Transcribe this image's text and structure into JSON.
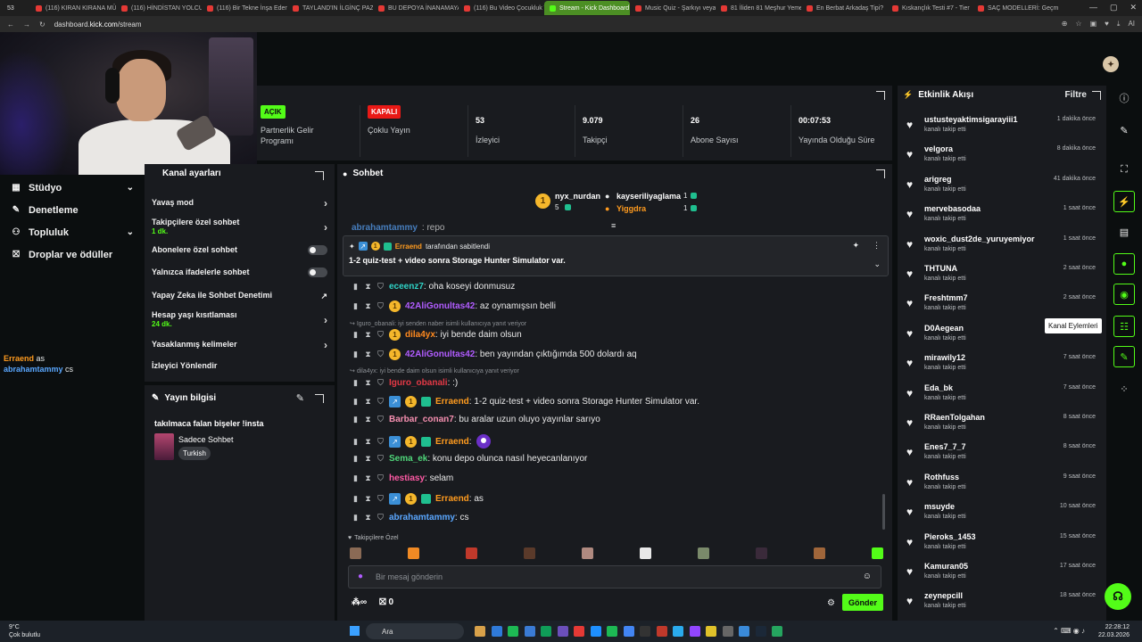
{
  "browser": {
    "tabs": [
      {
        "label": "(116) KIRAN KIRANA MÜC"
      },
      {
        "label": "(116) HİNDİSTAN YOLCU"
      },
      {
        "label": "(116) Bir Tekne İnşa Eden"
      },
      {
        "label": "TAYLAND'IN İLGİNÇ PAZ"
      },
      {
        "label": "BU DEPOYA İNANAMAYAC"
      },
      {
        "label": "(116) Bu Video Çocukluk T"
      },
      {
        "label": "Stream - Kick Dashboard",
        "active": true
      },
      {
        "label": "Music Quiz - Şarkıyı veya"
      },
      {
        "label": "81 İliden 81 Meşhur Yemek"
      },
      {
        "label": "En Berbat Arkadaş Tipi?"
      },
      {
        "label": "Kıskançlık Testi #7 - Tier"
      },
      {
        "label": "SAÇ MODELLERİ: Geçmiş"
      }
    ],
    "tab_count": "53",
    "url_prefix": "dashboard.",
    "url_domain": "kick.com",
    "url_path": "/stream",
    "ai_label": "AI"
  },
  "left_nav": {
    "items": [
      {
        "label": "Stüdyo",
        "icon": "studio-icon",
        "chevron": true
      },
      {
        "label": "Denetleme",
        "icon": "wrench-icon"
      },
      {
        "label": "Topluluk",
        "icon": "community-icon",
        "chevron": true
      },
      {
        "label": "Droplar ve ödüller",
        "icon": "drops-icon"
      }
    ]
  },
  "overlay_chat": [
    {
      "user": "Erraend",
      "text": "as"
    },
    {
      "user": "abrahamtammy",
      "text": "cs"
    }
  ],
  "stats": {
    "partner": {
      "pill": "AÇIK",
      "label_line1": "Partnerlik Gelir",
      "label_line2": "Programı"
    },
    "multistream": {
      "pill": "KAPALI",
      "label": "Çoklu Yayın"
    },
    "viewers": {
      "value": "53",
      "label": "İzleyici"
    },
    "followers": {
      "value": "9.079",
      "label": "Takipçi"
    },
    "subs": {
      "value": "26",
      "label": "Abone Sayısı"
    },
    "uptime": {
      "value": "00:07:53",
      "label": "Yayında Olduğu Süre"
    }
  },
  "mod_panel": {
    "title": "Kanal ayarları",
    "items": [
      {
        "label": "Yavaş mod",
        "type": "chevron"
      },
      {
        "label": "Takipçilere özel sohbet",
        "sub": "1 dk.",
        "type": "chevron"
      },
      {
        "label": "Abonelere özel sohbet",
        "type": "toggle"
      },
      {
        "label": "Yalnızca ifadelerle sohbet",
        "type": "toggle"
      },
      {
        "label": "Yapay Zeka ile Sohbet Denetimi",
        "type": "link"
      },
      {
        "label": "Hesap yaşı kısıtlaması",
        "sub": "24 dk.",
        "type": "chevron"
      },
      {
        "label": "Yasaklanmış kelimeler",
        "type": "chevron"
      },
      {
        "label": "İzleyici Yönlendir",
        "type": "none"
      }
    ]
  },
  "stream_info": {
    "title": "Yayın bilgisi",
    "stream_title": "takılmaca falan bişeler !insta",
    "category": "Sadece Sohbet",
    "language": "Turkish"
  },
  "chat": {
    "title": "Sohbet",
    "leaders": [
      {
        "name": "nyx_nurdan",
        "count": "5"
      },
      {
        "name": "kayseriliyaglama",
        "count": "1"
      },
      {
        "name": "Yiggdra",
        "count": "1"
      }
    ],
    "cut_message": {
      "user": "abrahamtammy",
      "text": ": repo"
    },
    "pinned": {
      "by_user": "Erraend",
      "by_text": "tarafından sabitlendi",
      "text": "1-2 quiz-test + video sonra Storage Hunter Simulator var."
    },
    "messages": [
      {
        "user": "eceenz7",
        "color": "#2fd3c6",
        "text": ": oha koseyi donmusuz",
        "badges": []
      },
      {
        "user": "42AliGonultas42",
        "color": "#b15cff",
        "text": ": az oynamışsın belli",
        "badges": [
          "sub"
        ]
      },
      {
        "reply": "Iguro_obanali: iyi senden naber isimli kullanıcıya yanıt veriyor"
      },
      {
        "user": "dila4yx",
        "color": "#ff8a1f",
        "text": ": iyi bende daim olsun",
        "badges": [
          "sub"
        ]
      },
      {
        "user": "42AliGonultas42",
        "color": "#b15cff",
        "text": ": ben yayından çıktığımda 500 dolardı aq",
        "badges": [
          "sub"
        ]
      },
      {
        "reply": "dila4yx: iyi bende daim olsun isimli kullanıcıya yanıt veriyor"
      },
      {
        "user": "Iguro_obanali",
        "color": "#e53946",
        "text": ": :)",
        "badges": []
      },
      {
        "user": "Erraend",
        "color": "#ff9b1f",
        "text": ": 1-2 quiz-test + video sonra Storage Hunter Simulator var.",
        "badges": [
          "vip",
          "sub",
          "gift"
        ]
      },
      {
        "user": "Barbar_conan7",
        "color": "#f58fb0",
        "text": ": bu aralar uzun oluyo yayınlar sarıyo",
        "badges": []
      },
      {
        "user": "Erraend",
        "color": "#ff9b1f",
        "text": ":",
        "badges": [
          "vip",
          "sub",
          "gift"
        ],
        "emote": true
      },
      {
        "user": "Sema_ek",
        "color": "#4fd67a",
        "text": ": konu depo olunca nasıl heyecanlanıyor",
        "badges": []
      },
      {
        "user": "hestiasy",
        "color": "#ff5aa5",
        "text": ": selam",
        "badges": []
      },
      {
        "user": "Erraend",
        "color": "#ff9b1f",
        "text": ": as",
        "badges": [
          "vip",
          "sub",
          "gift"
        ]
      },
      {
        "user": "abrahamtammy",
        "color": "#5aa7ff",
        "text": ": cs",
        "badges": []
      }
    ],
    "followers_only_label": "Takipçilere Özel",
    "input_placeholder": "Bir mesaj gönderin",
    "infinity_label": "∞",
    "gift_count": "0",
    "send_label": "Gönder"
  },
  "activity": {
    "title": "Etkinlik Akışı",
    "filter": "Filtre",
    "items": [
      {
        "name": "ustusteyaktimsigarayiii1",
        "sub": "kanalı takip etti",
        "time": "1 dakika önce"
      },
      {
        "name": "velgora",
        "sub": "kanalı takip etti",
        "time": "8 dakika önce"
      },
      {
        "name": "arigreg",
        "sub": "kanalı takip etti",
        "time": "41 dakika önce"
      },
      {
        "name": "mervebasodaa",
        "sub": "kanalı takip etti",
        "time": "1 saat önce"
      },
      {
        "name": "woxic_dust2de_yuruyemiyor",
        "sub": "kanalı takip etti",
        "time": "1 saat önce"
      },
      {
        "name": "THTUNA",
        "sub": "kanalı takip etti",
        "time": "2 saat önce"
      },
      {
        "name": "Freshtmm7",
        "sub": "kanalı takip etti",
        "time": "2 saat önce"
      },
      {
        "name": "D0Aegean",
        "sub": "kanalı takip etti",
        "time": ""
      },
      {
        "name": "mirawily12",
        "sub": "kanalı takip etti",
        "time": "7 saat önce"
      },
      {
        "name": "Eda_bk",
        "sub": "kanalı takip etti",
        "time": "7 saat önce"
      },
      {
        "name": "RRaenTolgahan",
        "sub": "kanalı takip etti",
        "time": "8 saat önce"
      },
      {
        "name": "Enes7_7_7",
        "sub": "kanalı takip etti",
        "time": "8 saat önce"
      },
      {
        "name": "Rothfuss",
        "sub": "kanalı takip etti",
        "time": "9 saat önce"
      },
      {
        "name": "msuyde",
        "sub": "kanalı takip etti",
        "time": "10 saat önce"
      },
      {
        "name": "Pieroks_1453",
        "sub": "kanalı takip etti",
        "time": "15 saat önce"
      },
      {
        "name": "Kamuran05",
        "sub": "kanalı takip etti",
        "time": "17 saat önce"
      },
      {
        "name": "zeynepcill",
        "sub": "kanalı takip etti",
        "time": "18 saat önce"
      }
    ]
  },
  "rail": {
    "tooltip": "Kanal Eylemleri"
  },
  "taskbar": {
    "weather_temp": "9°C",
    "weather_desc": "Çok bulutlu",
    "search": "Ara",
    "time": "22:28:12",
    "date": "22.03.2026"
  }
}
